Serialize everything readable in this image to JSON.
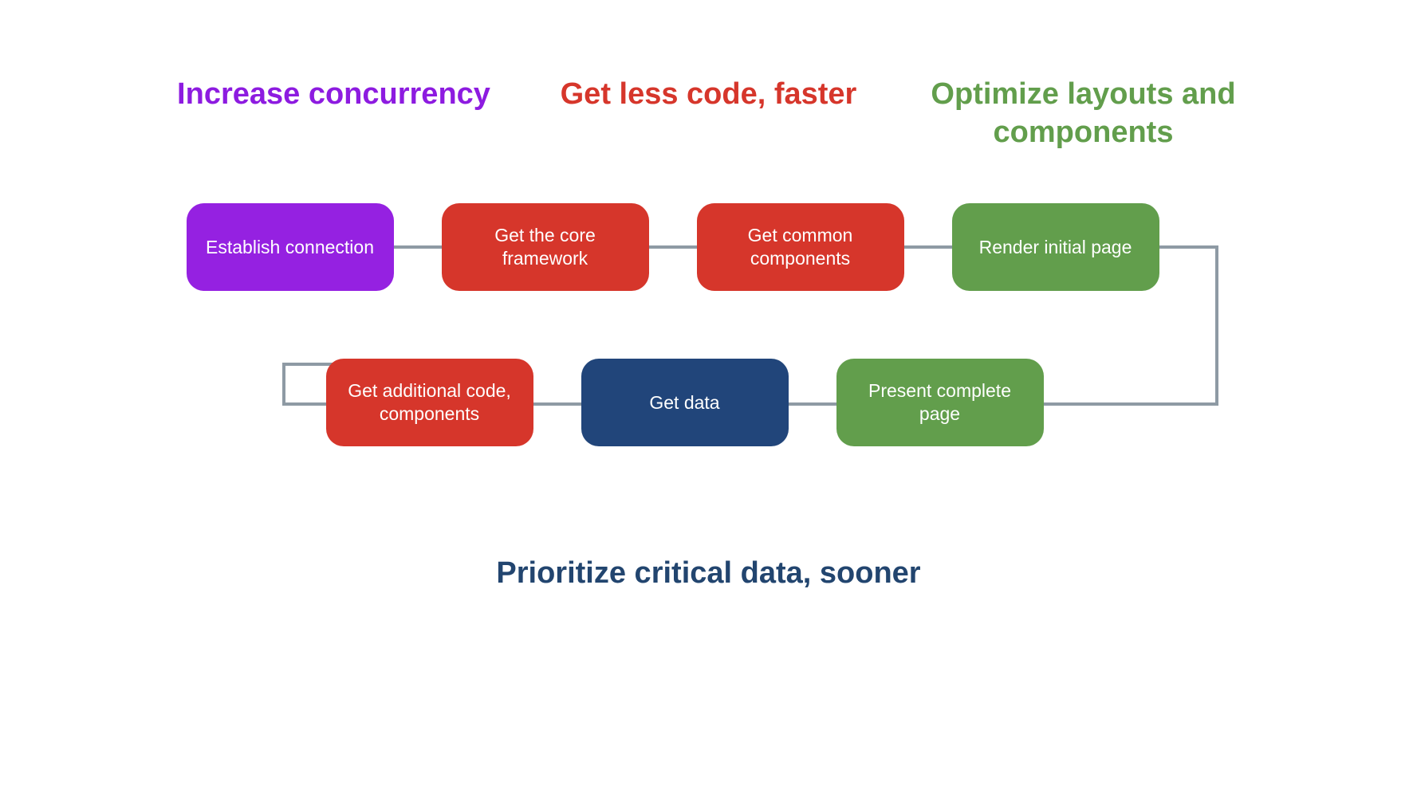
{
  "headers": {
    "left": "Increase concurrency",
    "center": "Get less code, faster",
    "right": "Optimize layouts and components"
  },
  "nodes": {
    "n1": "Establish connection",
    "n2": "Get the core framework",
    "n3": "Get common components",
    "n4": "Render initial page",
    "n5": "Get additional code, components",
    "n6": "Get data",
    "n7": "Present complete page"
  },
  "footer": "Prioritize critical data, sooner",
  "colors": {
    "purple": "#9521e1",
    "red": "#d6362b",
    "green": "#629e4c",
    "navy": "#21457a",
    "headerPurple": "#8d1be0",
    "headerGreen": "#629e4c",
    "footerNavy": "#22456f",
    "connector": "#8e9aa4"
  }
}
